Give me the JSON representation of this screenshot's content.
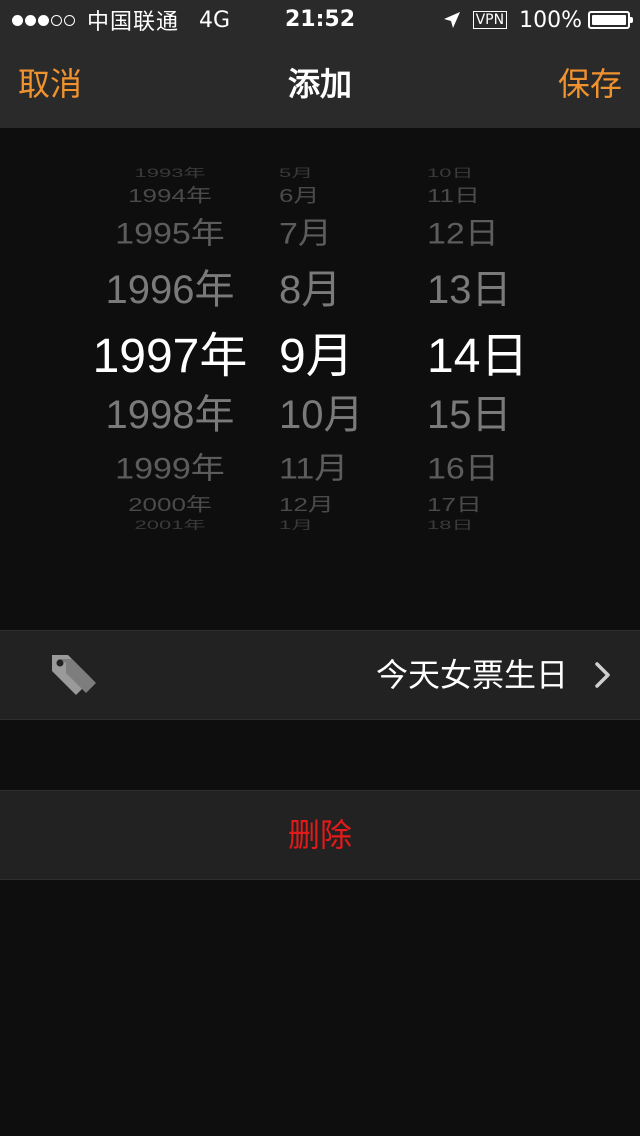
{
  "status_bar": {
    "signal_dots_filled": 3,
    "signal_dots_total": 5,
    "carrier": "中国联通",
    "network": "4G",
    "time": "21:52",
    "location_icon": "location-arrow-icon",
    "vpn": "VPN",
    "battery_percent": "100%",
    "battery_level": 1.0
  },
  "nav": {
    "cancel_label": "取消",
    "title": "添加",
    "save_label": "保存"
  },
  "picker": {
    "years": [
      "1993年",
      "1994年",
      "1995年",
      "1996年",
      "1997年",
      "1998年",
      "1999年",
      "2000年",
      "2001年"
    ],
    "months": [
      "5月",
      "6月",
      "7月",
      "8月",
      "9月",
      "10月",
      "11月",
      "12月",
      "1月"
    ],
    "days": [
      "10日",
      "11日",
      "12日",
      "13日",
      "14日",
      "15日",
      "16日",
      "17日",
      "18日"
    ],
    "selected": {
      "year": "1997年",
      "month": "9月",
      "day": "14日"
    }
  },
  "tag_row": {
    "icon": "tags-icon",
    "text": "今天女票生日",
    "chevron": "chevron-right-icon"
  },
  "delete_row": {
    "label": "删除"
  },
  "colors": {
    "accent": "#f0932f",
    "destructive": "#e21a1a",
    "bar_background": "#2a2a2a",
    "background": "#0e0e0e",
    "cell_background": "#222222"
  }
}
